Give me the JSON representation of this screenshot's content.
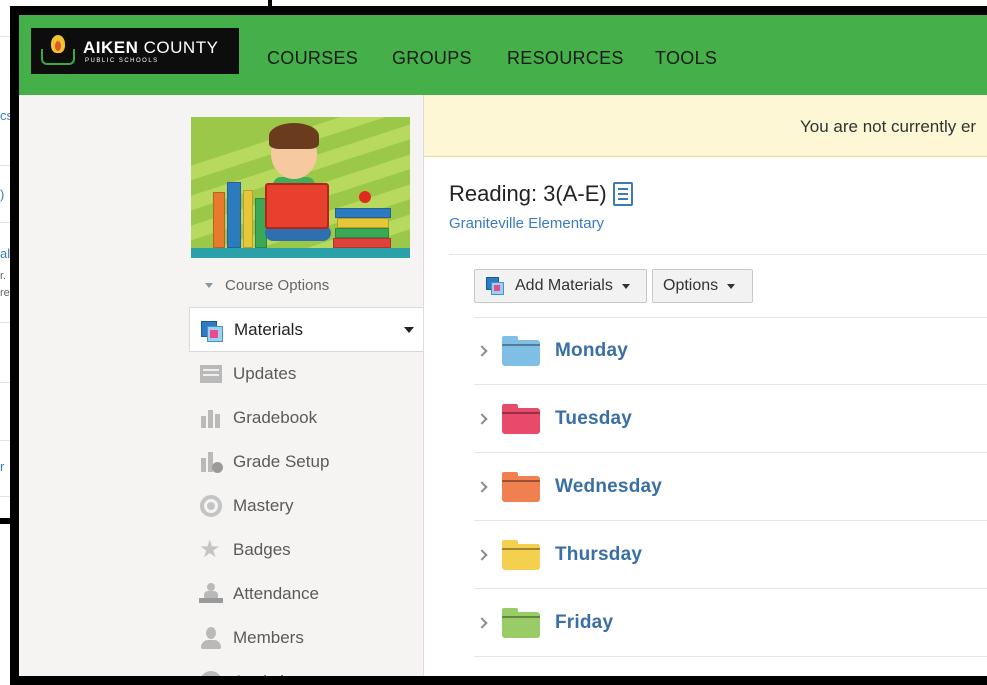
{
  "header": {
    "logo_title_bold": "AIKEN",
    "logo_title_thin": "COUNTY",
    "logo_subtitle": "PUBLIC SCHOOLS",
    "nav": [
      "COURSES",
      "GROUPS",
      "RESOURCES",
      "TOOLS"
    ]
  },
  "sidebar": {
    "course_options_label": "Course Options",
    "items": [
      {
        "label": "Materials",
        "icon": "materials-icon",
        "active": true
      },
      {
        "label": "Updates",
        "icon": "updates-icon"
      },
      {
        "label": "Gradebook",
        "icon": "gradebook-icon"
      },
      {
        "label": "Grade Setup",
        "icon": "grade-setup-icon"
      },
      {
        "label": "Mastery",
        "icon": "mastery-icon"
      },
      {
        "label": "Badges",
        "icon": "badges-icon"
      },
      {
        "label": "Attendance",
        "icon": "attendance-icon"
      },
      {
        "label": "Members",
        "icon": "members-icon"
      },
      {
        "label": "Analytics",
        "icon": "analytics-icon"
      }
    ]
  },
  "banner": {
    "text": "You are not currently er"
  },
  "course": {
    "title": "Reading: 3(A-E)",
    "school": "Graniteville Elementary"
  },
  "toolbar": {
    "add_materials_label": "Add Materials",
    "options_label": "Options"
  },
  "folders": [
    {
      "label": "Monday",
      "color": "#7fbfe6"
    },
    {
      "label": "Tuesday",
      "color": "#e84a6a"
    },
    {
      "label": "Wednesday",
      "color": "#f08050"
    },
    {
      "label": "Thursday",
      "color": "#f3d04d"
    },
    {
      "label": "Friday",
      "color": "#99cc66"
    }
  ],
  "colors": {
    "nav_green": "#45b04a",
    "link_blue": "#3b7bbf",
    "banner_yellow": "#fdf7d6"
  }
}
